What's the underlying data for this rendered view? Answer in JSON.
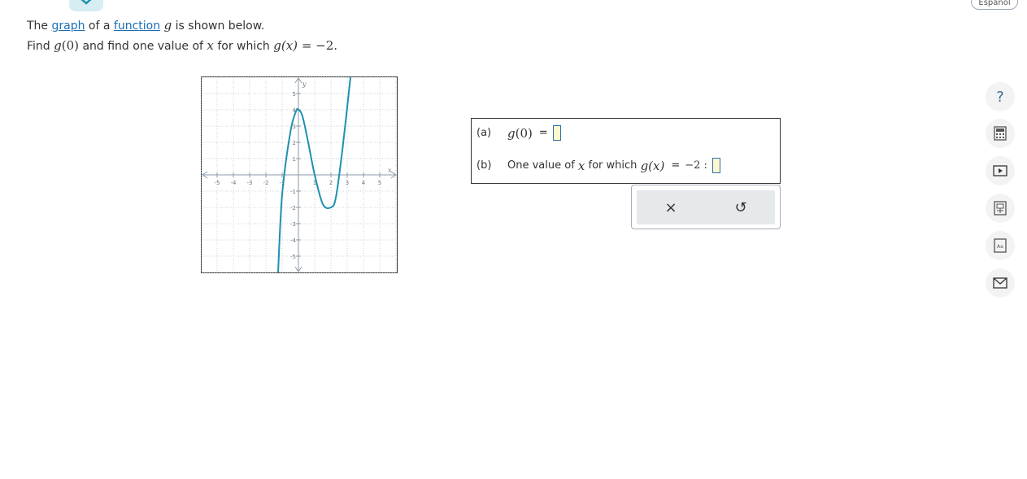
{
  "header": {
    "language_toggle": "Español"
  },
  "prompt": {
    "line1_pre": "The ",
    "line1_link1": "graph",
    "line1_mid": " of a ",
    "line1_link2": "function",
    "line1_var": "g",
    "line1_post": " is shown below.",
    "line2_pre": "Find ",
    "line2_g": "g",
    "line2_arg": "(0)",
    "line2_mid": " and find one value of ",
    "line2_x": "x",
    "line2_for": " for which ",
    "line2_g2": "g",
    "line2_arg2": "(x)",
    "line2_eq": " = −2."
  },
  "graph": {
    "x_axis_label": "x",
    "y_axis_label": "y",
    "x_ticks": [
      "-5",
      "-4",
      "-3",
      "-2",
      "-1",
      "1",
      "2",
      "3",
      "4",
      "5"
    ],
    "y_ticks": [
      "5",
      "4",
      "3",
      "2",
      "1",
      "-1",
      "-2",
      "-3",
      "-4",
      "-5"
    ],
    "curve_color": "#1e90b0",
    "curve_points": [
      [
        -1.25,
        -6
      ],
      [
        -1,
        -1.2
      ],
      [
        -0.5,
        2.6
      ],
      [
        -0.15,
        3.9
      ],
      [
        0,
        4
      ],
      [
        0.25,
        3.6
      ],
      [
        0.6,
        2
      ],
      [
        1,
        0
      ],
      [
        1.5,
        -1.8
      ],
      [
        2,
        -2
      ],
      [
        2.3,
        -1.4
      ],
      [
        2.7,
        1.5
      ],
      [
        3.2,
        6
      ]
    ]
  },
  "answers": {
    "a_label": "(a)",
    "a_text_g": "g",
    "a_text_arg": "(0)",
    "a_eq": "=",
    "b_label": "(b)",
    "b_text": "One value of",
    "b_x": "x",
    "b_for": "for which",
    "b_g": "g",
    "b_arg": "(x)",
    "b_eq": "=",
    "b_val": "−2 :"
  },
  "tools": {
    "clear_icon": "×",
    "undo_icon": "↺"
  },
  "sidebar": [
    "help-icon",
    "calculator-icon",
    "video-icon",
    "textbook-icon",
    "glossary-icon",
    "message-icon"
  ]
}
